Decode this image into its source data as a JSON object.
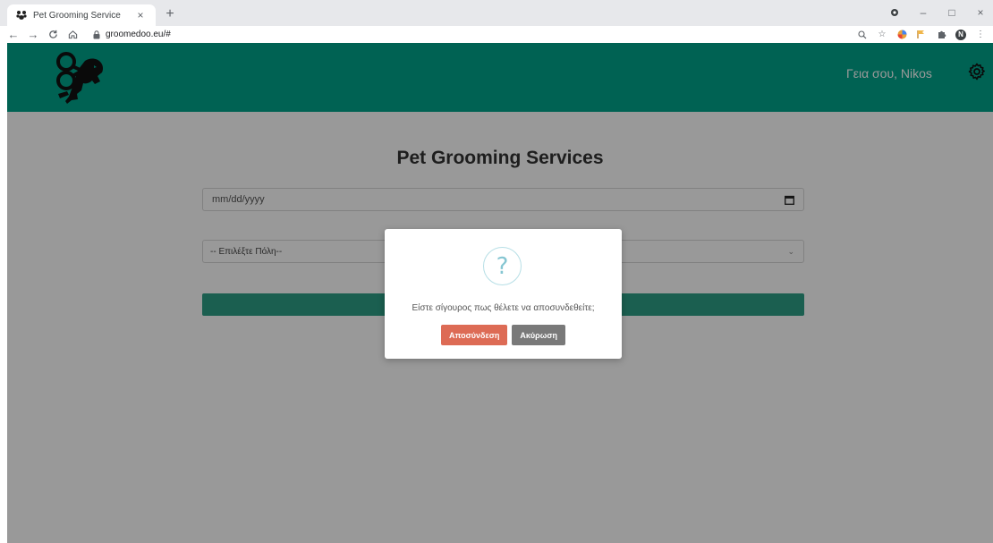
{
  "browser": {
    "tab_title": "Pet Grooming Service",
    "tab_close": "×",
    "new_tab": "+",
    "url": "groomedoo.eu/#",
    "window_controls": {
      "minimize": "–",
      "maximize": "□",
      "close": "×"
    },
    "profile_initial": "N"
  },
  "header": {
    "greeting": "Γεια σου, Nikos",
    "background_color": "#00a48a",
    "logo_icon": "scissors-dog-logo",
    "settings_icon": "gear-icon"
  },
  "main": {
    "title": "Pet Grooming Services",
    "date_placeholder": "mm/dd/yyyy",
    "city_select_value": "-- Επιλέξτε Πόλη--",
    "search_button_label": ""
  },
  "modal": {
    "icon_symbol": "?",
    "message": "Είστε σίγουρος πως θέλετε να αποσυνδεθείτε;",
    "confirm_label": "Αποσύνδεση",
    "cancel_label": "Ακύρωση",
    "confirm_color": "#dd6b55",
    "cancel_color": "#797979"
  }
}
